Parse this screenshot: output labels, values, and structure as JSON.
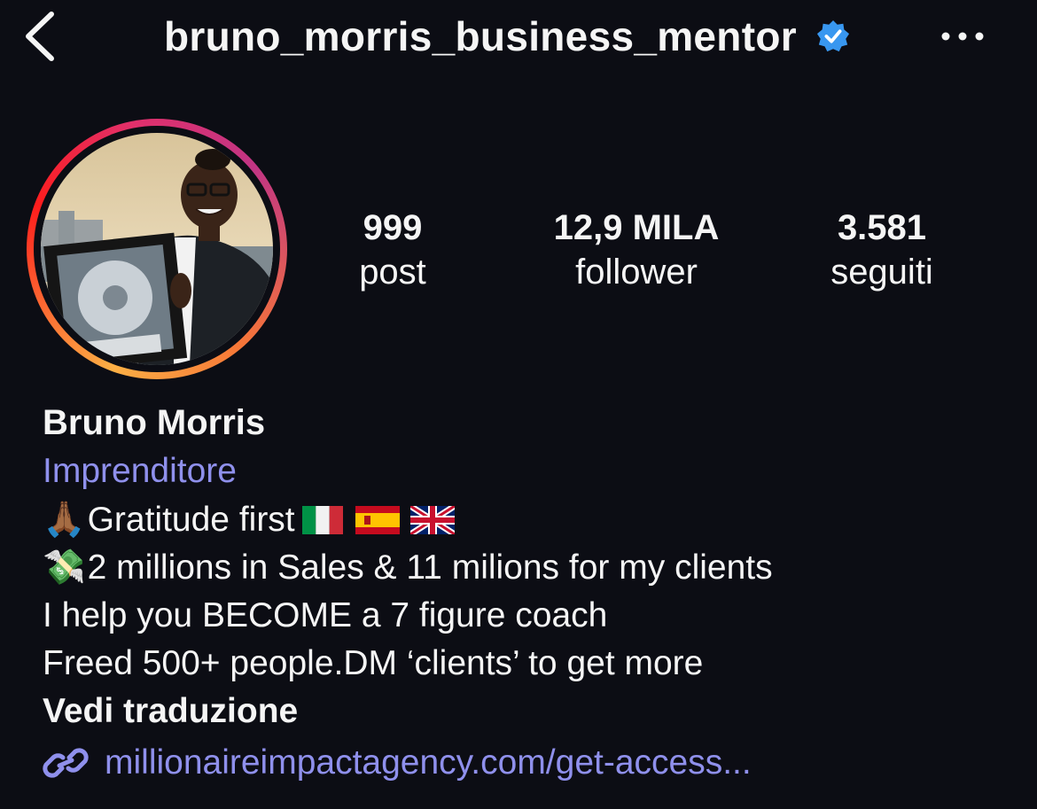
{
  "header": {
    "username": "bruno_morris_business_mentor",
    "verified": true,
    "back_icon": "chevron-left-icon",
    "more_icon": "more-horizontal-icon"
  },
  "profile": {
    "has_story_ring": true,
    "stats": [
      {
        "value": "999",
        "label": "post"
      },
      {
        "value": "12,9 MILA",
        "label": "follower"
      },
      {
        "value": "3.581",
        "label": "seguiti"
      }
    ],
    "full_name": "Bruno Morris",
    "category": "Imprenditore",
    "bio": {
      "line1_emoji": "🙏🏾",
      "line1_text": "Gratitude first",
      "line1_flags": [
        "italy-flag",
        "spain-flag",
        "uk-flag"
      ],
      "line2_emoji": "💸",
      "line2_text": "2 millions in Sales & 11 milions for my clients",
      "line3_text": "I help you BECOME a 7 figure coach",
      "line4_text": "Freed 500+ people.DM ‘clients’ to get more"
    },
    "translate_label": "Vedi traduzione",
    "link": {
      "icon": "link-icon",
      "text": "millionaireimpactagency.com/get-access..."
    }
  },
  "colors": {
    "background": "#0c0d14",
    "text": "#f5f5f5",
    "accent_link": "#8f90ec",
    "verified_badge": "#3897f0"
  }
}
